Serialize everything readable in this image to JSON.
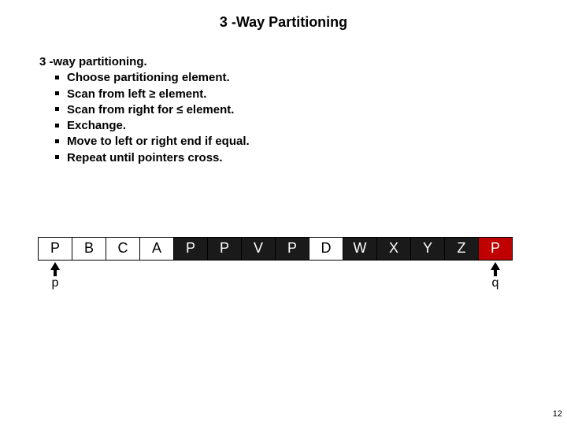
{
  "title": "3 -Way Partitioning",
  "heading": "3 -way partitioning.",
  "bullets": [
    "Choose partitioning element.",
    "Scan from left ≥ element.",
    "Scan from right for ≤  element.",
    "Exchange.",
    "Move to left or right end if equal.",
    "Repeat until pointers cross."
  ],
  "cells": [
    {
      "v": "P",
      "c": "white"
    },
    {
      "v": "B",
      "c": "white"
    },
    {
      "v": "C",
      "c": "white"
    },
    {
      "v": "A",
      "c": "white"
    },
    {
      "v": "P",
      "c": "dark"
    },
    {
      "v": "P",
      "c": "dark"
    },
    {
      "v": "V",
      "c": "dark"
    },
    {
      "v": "P",
      "c": "dark"
    },
    {
      "v": "D",
      "c": "white"
    },
    {
      "v": "W",
      "c": "dark"
    },
    {
      "v": "X",
      "c": "dark"
    },
    {
      "v": "Y",
      "c": "dark"
    },
    {
      "v": "Z",
      "c": "dark"
    },
    {
      "v": "P",
      "c": "red"
    }
  ],
  "pointers": {
    "p_index": 0,
    "p_label": "p",
    "q_index": 13,
    "q_label": "q"
  },
  "page": "12"
}
